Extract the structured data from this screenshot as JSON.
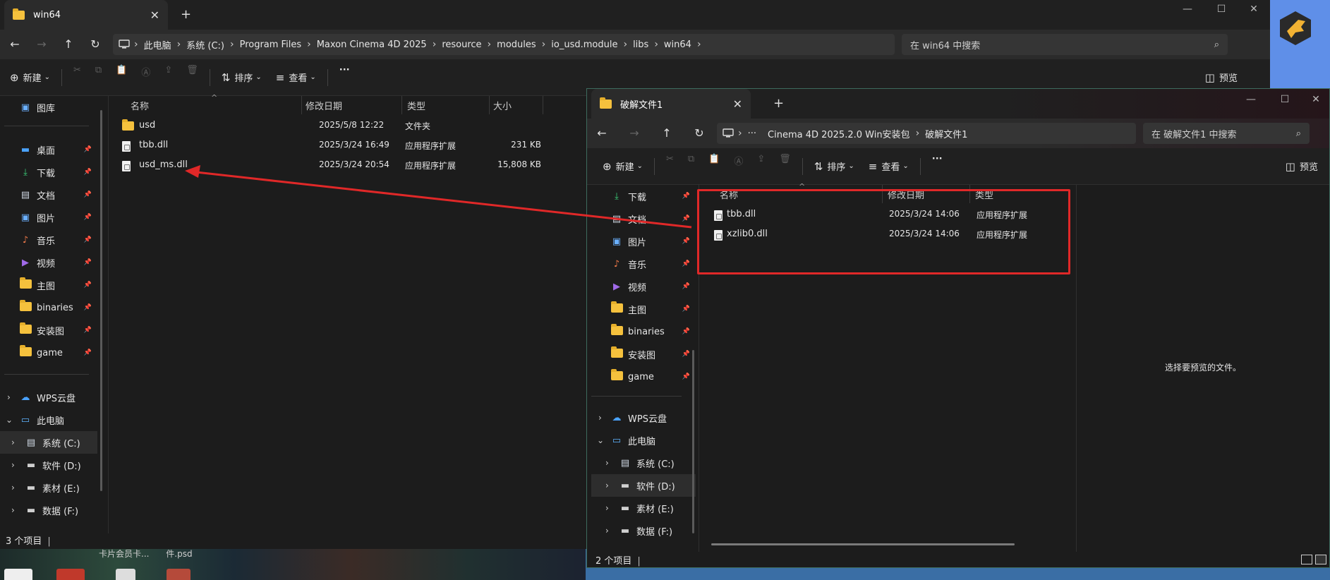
{
  "colors": {
    "accent": "#e02828",
    "folder": "#f5c13d",
    "window_bg": "#1c1c1c"
  },
  "desktop": {
    "files": [
      "卡片会员卡...",
      "件.psd"
    ]
  },
  "win1": {
    "tab_title": "win64",
    "breadcrumbs": [
      "此电脑",
      "系统 (C:)",
      "Program Files",
      "Maxon Cinema 4D 2025",
      "resource",
      "modules",
      "io_usd.module",
      "libs",
      "win64"
    ],
    "search_placeholder": "在 win64 中搜索",
    "toolbar": {
      "new": "新建",
      "sort": "排序",
      "view": "查看",
      "more": "···",
      "preview": "预览"
    },
    "nav": {
      "top_item": "图库",
      "quick": [
        {
          "label": "桌面",
          "icon": "desktop-icon"
        },
        {
          "label": "下载",
          "icon": "download-icon"
        },
        {
          "label": "文档",
          "icon": "document-icon"
        },
        {
          "label": "图片",
          "icon": "pictures-icon"
        },
        {
          "label": "音乐",
          "icon": "music-icon"
        },
        {
          "label": "视频",
          "icon": "video-icon"
        },
        {
          "label": "主图",
          "icon": "folder-icon"
        },
        {
          "label": "binaries",
          "icon": "folder-icon"
        },
        {
          "label": "安装图",
          "icon": "folder-icon"
        },
        {
          "label": "game",
          "icon": "folder-icon"
        }
      ],
      "cloud": "WPS云盘",
      "pc": "此电脑",
      "drives": [
        "系统 (C:)",
        "软件 (D:)",
        "素材 (E:)",
        "数据 (F:)"
      ]
    },
    "columns": [
      "名称",
      "修改日期",
      "类型",
      "大小"
    ],
    "files": [
      {
        "name": "usd",
        "date": "2025/5/8 12:22",
        "type": "文件夹",
        "size": "",
        "kind": "folder"
      },
      {
        "name": "tbb.dll",
        "date": "2025/3/24 16:49",
        "type": "应用程序扩展",
        "size": "231 KB",
        "kind": "file"
      },
      {
        "name": "usd_ms.dll",
        "date": "2025/3/24 20:54",
        "type": "应用程序扩展",
        "size": "15,808 KB",
        "kind": "file"
      }
    ],
    "status": "3 个项目"
  },
  "win2": {
    "tab_title": "破解文件1",
    "breadcrumbs": [
      "···",
      "Cinema 4D 2025.2.0 Win安装包",
      "破解文件1"
    ],
    "search_placeholder": "在 破解文件1 中搜索",
    "toolbar": {
      "new": "新建",
      "sort": "排序",
      "view": "查看",
      "more": "···",
      "preview": "预览"
    },
    "nav": {
      "quick": [
        {
          "label": "下载",
          "icon": "download-icon"
        },
        {
          "label": "文档",
          "icon": "document-icon"
        },
        {
          "label": "图片",
          "icon": "pictures-icon"
        },
        {
          "label": "音乐",
          "icon": "music-icon"
        },
        {
          "label": "视频",
          "icon": "video-icon"
        },
        {
          "label": "主图",
          "icon": "folder-icon"
        },
        {
          "label": "binaries",
          "icon": "folder-icon"
        },
        {
          "label": "安装图",
          "icon": "folder-icon"
        },
        {
          "label": "game",
          "icon": "folder-icon"
        }
      ],
      "cloud": "WPS云盘",
      "pc": "此电脑",
      "drives": [
        "系统 (C:)",
        "软件 (D:)",
        "素材 (E:)",
        "数据 (F:)"
      ]
    },
    "columns": [
      "名称",
      "修改日期",
      "类型"
    ],
    "files": [
      {
        "name": "tbb.dll",
        "date": "2025/3/24 14:06",
        "type": "应用程序扩展"
      },
      {
        "name": "xzlib0.dll",
        "date": "2025/3/24 14:06",
        "type": "应用程序扩展"
      }
    ],
    "preview_text": "选择要预览的文件。",
    "status": "2 个项目"
  }
}
